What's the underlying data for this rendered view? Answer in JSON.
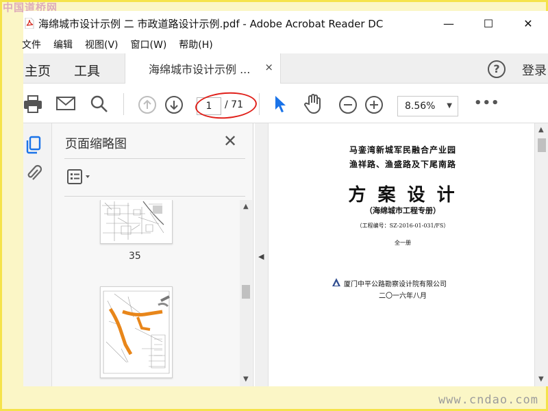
{
  "watermarks": {
    "top": "中国道桥网",
    "bottom": "www.cndao.com"
  },
  "window": {
    "title": "海绵城市设计示例 二 市政道路设计示例.pdf - Adobe Acrobat Reader DC",
    "controls": {
      "minimize": "—",
      "maximize": "☐",
      "close": "✕"
    }
  },
  "menu": {
    "items": [
      "文件",
      "编辑",
      "视图(V)",
      "窗口(W)",
      "帮助(H)"
    ]
  },
  "tabs": {
    "home": "主页",
    "tools": "工具",
    "document": "海绵城市设计示例 ...",
    "close": "×",
    "help": "?",
    "signin": "登录"
  },
  "toolbar": {
    "current_page": "1",
    "total_pages": "/ 71",
    "zoom": "8.56%",
    "zoom_caret": "▼",
    "more": "•••"
  },
  "thumbnails": {
    "title": "页面缩略图",
    "close": "✕",
    "pages": [
      {
        "number": "35"
      }
    ]
  },
  "document": {
    "line1": "马銮湾新城军民融合产业园",
    "line2": "渔祥路、渔盛路及下尾南路",
    "heading": "方 案 设 计",
    "subtitle": "（海绵城市工程专册）",
    "project_no": "（工程编号：SZ-2016-01-031/FS）",
    "volume": "全一册",
    "company": "厦门中平公路勘察设计院有限公司",
    "date": "二〇一六年八月"
  },
  "colors": {
    "accent_blue": "#1a73e8",
    "highlight_red": "#e0201a",
    "frame_yellow": "#f5e34a",
    "route_orange": "#e8861a"
  }
}
